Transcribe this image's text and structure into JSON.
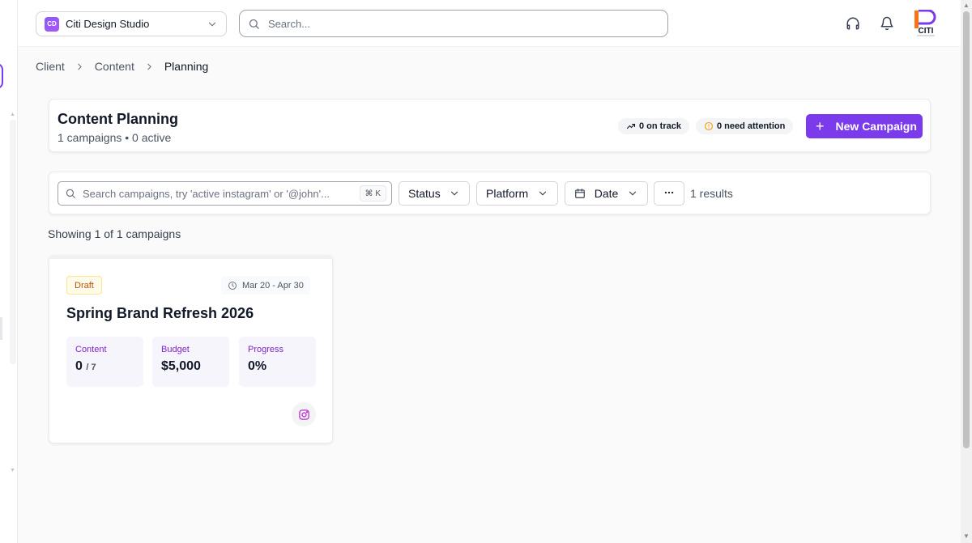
{
  "colors": {
    "accent": "#7c3aed",
    "draft_badge": "#b45309",
    "on_track": "#111827",
    "attention": "#f59e0b",
    "instagram": "#c026d3"
  },
  "topbar": {
    "workspace": {
      "logo_text": "CD",
      "name": "Citi Design Studio",
      "icon": "chevron-down-icon"
    },
    "search": {
      "placeholder": "Search..."
    },
    "icons": [
      "headset-icon",
      "bell-icon"
    ],
    "brand_logo": {
      "text": "CITI"
    }
  },
  "breadcrumb": [
    "Client",
    "Content",
    "Planning"
  ],
  "header": {
    "title": "Content Planning",
    "subtitle": "1 campaigns • 0 active",
    "on_track": "0 on track",
    "need_attention": "0 need attention",
    "new_campaign_label": "New Campaign"
  },
  "filters": {
    "search_placeholder": "Search campaigns, try 'active instagram' or '@john'...",
    "shortcut": "⌘ K",
    "status_label": "Status",
    "platform_label": "Platform",
    "date_label": "Date",
    "more_icon": "ellipsis-icon",
    "results": "1 results"
  },
  "showing": "Showing 1 of 1 campaigns",
  "campaigns": [
    {
      "status": "Draft",
      "date_range": "Mar 20 - Apr 30",
      "title": "Spring Brand Refresh 2026",
      "content_label": "Content",
      "content_value": "0",
      "content_total": "/ 7",
      "budget_label": "Budget",
      "budget_value": "$5,000",
      "progress_label": "Progress",
      "progress_value": "0%",
      "platform_icon": "instagram-icon"
    }
  ]
}
